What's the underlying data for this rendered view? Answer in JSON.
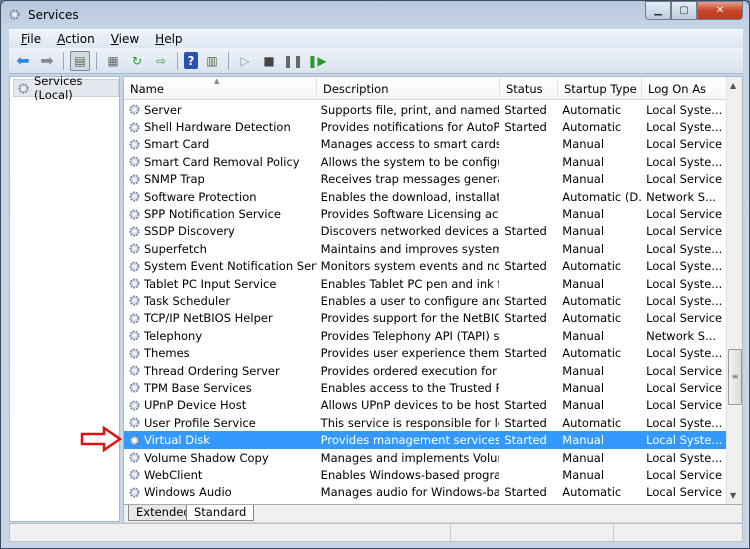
{
  "window": {
    "title": "Services"
  },
  "menu": [
    {
      "label": "File",
      "key": "F",
      "rest": "ile"
    },
    {
      "label": "Action",
      "key": "A",
      "rest": "ction"
    },
    {
      "label": "View",
      "key": "V",
      "rest": "iew"
    },
    {
      "label": "Help",
      "key": "H",
      "rest": "elp"
    }
  ],
  "tree": {
    "root": "Services (Local)"
  },
  "columns": [
    "Name",
    "Description",
    "Status",
    "Startup Type",
    "Log On As"
  ],
  "selected": "Virtual Disk",
  "highlight_color": "#3399ff",
  "services": [
    [
      "Server",
      "Supports file, print, and named-pi...",
      "Started",
      "Automatic",
      "Local Syste..."
    ],
    [
      "Shell Hardware Detection",
      "Provides notifications for AutoPla...",
      "Started",
      "Automatic",
      "Local Syste..."
    ],
    [
      "Smart Card",
      "Manages access to smart cards re...",
      "",
      "Manual",
      "Local Service"
    ],
    [
      "Smart Card Removal Policy",
      "Allows the system to be configure...",
      "",
      "Manual",
      "Local Syste..."
    ],
    [
      "SNMP Trap",
      "Receives trap messages generated...",
      "",
      "Manual",
      "Local Service"
    ],
    [
      "Software Protection",
      "Enables the download, installatio...",
      "",
      "Automatic (D...",
      "Network S..."
    ],
    [
      "SPP Notification Service",
      "Provides Software Licensing activ...",
      "",
      "Manual",
      "Local Service"
    ],
    [
      "SSDP Discovery",
      "Discovers networked devices and ...",
      "Started",
      "Manual",
      "Local Service"
    ],
    [
      "Superfetch",
      "Maintains and improves system p...",
      "",
      "Manual",
      "Local Syste..."
    ],
    [
      "System Event Notification Service",
      "Monitors system events and notifi...",
      "Started",
      "Automatic",
      "Local Syste..."
    ],
    [
      "Tablet PC Input Service",
      "Enables Tablet PC pen and ink fu...",
      "",
      "Manual",
      "Local Syste..."
    ],
    [
      "Task Scheduler",
      "Enables a user to configure and sc...",
      "Started",
      "Automatic",
      "Local Syste..."
    ],
    [
      "TCP/IP NetBIOS Helper",
      "Provides support for the NetBIOS ...",
      "Started",
      "Automatic",
      "Local Service"
    ],
    [
      "Telephony",
      "Provides Telephony API (TAPI) su...",
      "",
      "Manual",
      "Network S..."
    ],
    [
      "Themes",
      "Provides user experience theme ...",
      "Started",
      "Automatic",
      "Local Syste..."
    ],
    [
      "Thread Ordering Server",
      "Provides ordered execution for a ...",
      "",
      "Manual",
      "Local Service"
    ],
    [
      "TPM Base Services",
      "Enables access to the Trusted Plat...",
      "",
      "Manual",
      "Local Service"
    ],
    [
      "UPnP Device Host",
      "Allows UPnP devices to be hosted...",
      "Started",
      "Manual",
      "Local Service"
    ],
    [
      "User Profile Service",
      "This service is responsible for load...",
      "Started",
      "Automatic",
      "Local Syste..."
    ],
    [
      "Virtual Disk",
      "Provides management services fo...",
      "Started",
      "Manual",
      "Local Syste..."
    ],
    [
      "Volume Shadow Copy",
      "Manages and implements Volum...",
      "",
      "Manual",
      "Local Syste..."
    ],
    [
      "WebClient",
      "Enables Windows-based program...",
      "",
      "Manual",
      "Local Service"
    ],
    [
      "Windows Audio",
      "Manages audio for Windows-bas...",
      "Started",
      "Automatic",
      "Local Service"
    ]
  ],
  "tabs": [
    "Extended",
    "Standard"
  ],
  "active_tab": "Standard",
  "scroll_position_percent": 70
}
